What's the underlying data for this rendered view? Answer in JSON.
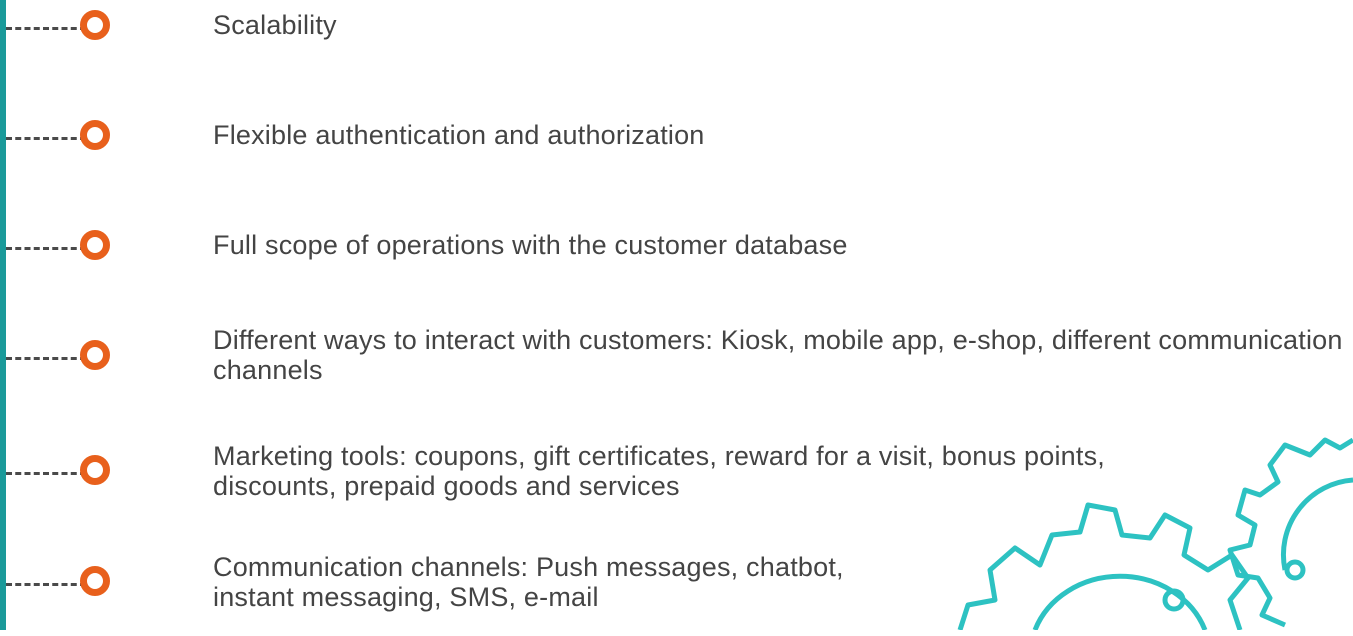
{
  "features": [
    {
      "text": "Scalability"
    },
    {
      "text": "Flexible authentication and authorization"
    },
    {
      "text": "Full scope of operations with the customer database"
    },
    {
      "text": "Different ways to interact with customers: Kiosk, mobile app, e-shop, different communication channels"
    },
    {
      "text": "Marketing tools: coupons, gift certificates, reward for a visit, bonus points, discounts, prepaid goods and services"
    },
    {
      "text": "Communication channels: Push messages, chatbot, instant messaging, SMS, e-mail"
    }
  ],
  "colors": {
    "accent": "#e8601c",
    "teal": "#1a9a9a",
    "gear": "#2dc2c2",
    "text": "#444444"
  },
  "icons": {
    "bullet": "ring-node-icon",
    "illustration": "gears-icon"
  }
}
